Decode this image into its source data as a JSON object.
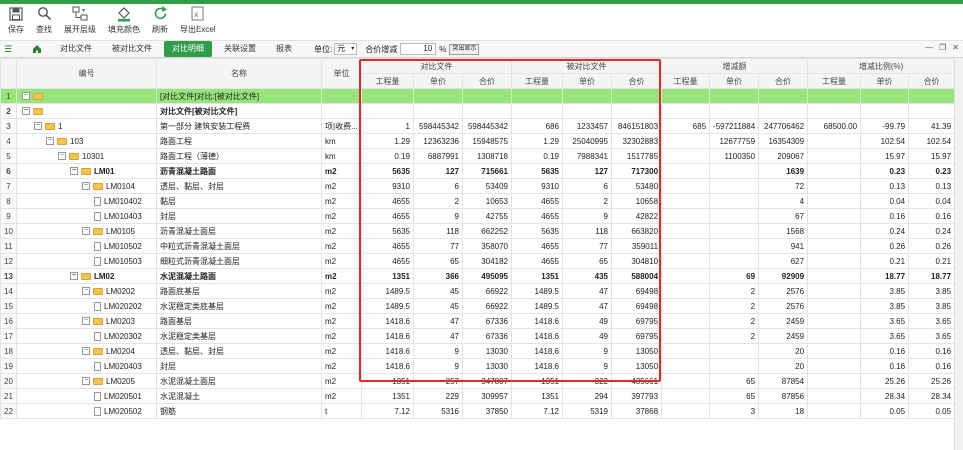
{
  "toolbar": {
    "items": [
      {
        "label": "保存",
        "icon": "save-icon"
      },
      {
        "label": "查找",
        "icon": "search-icon"
      },
      {
        "label": "展开层级",
        "icon": "expand-icon"
      },
      {
        "label": "填充颜色",
        "icon": "paint-bucket-icon"
      },
      {
        "label": "刷新",
        "icon": "refresh-icon"
      },
      {
        "label": "导出Excel",
        "icon": "excel-icon"
      }
    ]
  },
  "tabs": {
    "items": [
      "对比文件",
      "被对比文件",
      "对比明细",
      "关联设置",
      "报表"
    ],
    "active_index": 2,
    "unit_label": "单位:",
    "unit_value": "元",
    "ratio_label": "合价增减",
    "ratio_value": "10",
    "ratio_unit": "%",
    "display_button": "突出显示"
  },
  "colors": {
    "accent": "#2f9e49",
    "highlight_row": "#97e57a",
    "red_box": "#e02b2b"
  },
  "grid": {
    "headers": {
      "code": "编号",
      "name": "名称",
      "unit": "单位",
      "group_compare": "对比文件",
      "group_target": "被对比文件",
      "group_delta": "增减额",
      "group_ratio": "增减比例(%)",
      "qty": "工程量",
      "price": "单价",
      "total": "合价"
    },
    "rows": [
      {
        "rn": "1",
        "code": "",
        "level": 0,
        "kind": "folder",
        "name": "[对比文件]对比:[被对比文件]",
        "unit": "",
        "c": [
          "",
          "",
          "",
          "",
          "",
          "",
          "",
          "",
          "",
          "",
          "",
          ""
        ],
        "style": "green"
      },
      {
        "rn": "2",
        "code": "",
        "level": 0,
        "kind": "folder",
        "name": "对比文件[被对比文件]",
        "unit": "",
        "c": [
          "",
          "",
          "",
          "",
          "",
          "",
          "",
          "",
          "",
          "",
          "",
          ""
        ],
        "style": "bold"
      },
      {
        "rn": "3",
        "code": "1",
        "level": 1,
        "kind": "folder",
        "name": "第一部分 建筑安装工程费",
        "unit": "项|收费...",
        "c": [
          "1",
          "598445342",
          "598445342",
          "686",
          "1233457",
          "846151803",
          "685",
          "-597211884",
          "247706462",
          "68500.00",
          "-99.79",
          "41.39"
        ]
      },
      {
        "rn": "4",
        "code": "103",
        "level": 2,
        "kind": "folder",
        "name": "路面工程",
        "unit": "km",
        "c": [
          "1.29",
          "12363236",
          "15948575",
          "1.29",
          "25040995",
          "32302883",
          "",
          "12677759",
          "16354309",
          "",
          "102.54",
          "102.54"
        ]
      },
      {
        "rn": "5",
        "code": "10301",
        "level": 3,
        "kind": "folder",
        "name": "路面工程（薄德）",
        "unit": "km",
        "c": [
          "0.19",
          "6887991",
          "1308718",
          "0.19",
          "7988341",
          "1517785",
          "",
          "1100350",
          "209067",
          "",
          "15.97",
          "15.97"
        ]
      },
      {
        "rn": "6",
        "code": "LM01",
        "level": 4,
        "kind": "folder",
        "name": "沥青混凝土路面",
        "unit": "m2",
        "c": [
          "5635",
          "127",
          "715661",
          "5635",
          "127",
          "717300",
          "",
          "",
          "1639",
          "",
          "0.23",
          "0.23"
        ],
        "style": "bold"
      },
      {
        "rn": "7",
        "code": "LM0104",
        "level": 5,
        "kind": "folder",
        "name": "透层、黏层、封层",
        "unit": "m2",
        "c": [
          "9310",
          "6",
          "53409",
          "9310",
          "6",
          "53480",
          "",
          "",
          "72",
          "",
          "0.13",
          "0.13"
        ]
      },
      {
        "rn": "8",
        "code": "LM010402",
        "level": 6,
        "kind": "doc",
        "name": "黏层",
        "unit": "m2",
        "c": [
          "4655",
          "2",
          "10653",
          "4655",
          "2",
          "10658",
          "",
          "",
          "4",
          "",
          "0.04",
          "0.04"
        ]
      },
      {
        "rn": "9",
        "code": "LM010403",
        "level": 6,
        "kind": "doc",
        "name": "封层",
        "unit": "m2",
        "c": [
          "4655",
          "9",
          "42755",
          "4655",
          "9",
          "42822",
          "",
          "",
          "67",
          "",
          "0.16",
          "0.16"
        ]
      },
      {
        "rn": "10",
        "code": "LM0105",
        "level": 5,
        "kind": "folder",
        "name": "沥青混凝土面层",
        "unit": "m2",
        "c": [
          "5635",
          "118",
          "662252",
          "5635",
          "118",
          "663820",
          "",
          "",
          "1568",
          "",
          "0.24",
          "0.24"
        ]
      },
      {
        "rn": "11",
        "code": "LM010502",
        "level": 6,
        "kind": "doc",
        "name": "中粒式沥青混凝土面层",
        "unit": "m2",
        "c": [
          "4655",
          "77",
          "358070",
          "4655",
          "77",
          "359011",
          "",
          "",
          "941",
          "",
          "0.26",
          "0.26"
        ]
      },
      {
        "rn": "12",
        "code": "LM010503",
        "level": 6,
        "kind": "doc",
        "name": "细粒式沥青混凝土面层",
        "unit": "m2",
        "c": [
          "4655",
          "65",
          "304182",
          "4655",
          "65",
          "304810",
          "",
          "",
          "627",
          "",
          "0.21",
          "0.21"
        ]
      },
      {
        "rn": "13",
        "code": "LM02",
        "level": 4,
        "kind": "folder",
        "name": "水泥混凝土路面",
        "unit": "m2",
        "c": [
          "1351",
          "366",
          "495095",
          "1351",
          "435",
          "588004",
          "",
          "69",
          "92909",
          "",
          "18.77",
          "18.77"
        ],
        "style": "bold"
      },
      {
        "rn": "14",
        "code": "LM0202",
        "level": 5,
        "kind": "folder",
        "name": "路面底基层",
        "unit": "m2",
        "c": [
          "1489.5",
          "45",
          "66922",
          "1489.5",
          "47",
          "69498",
          "",
          "2",
          "2576",
          "",
          "3.85",
          "3.85"
        ]
      },
      {
        "rn": "15",
        "code": "LM020202",
        "level": 6,
        "kind": "doc",
        "name": "水泥稳定类底基层",
        "unit": "m2",
        "c": [
          "1489.5",
          "45",
          "66922",
          "1489.5",
          "47",
          "69498",
          "",
          "2",
          "2576",
          "",
          "3.85",
          "3.85"
        ]
      },
      {
        "rn": "16",
        "code": "LM0203",
        "level": 5,
        "kind": "folder",
        "name": "路面基层",
        "unit": "m2",
        "c": [
          "1418.6",
          "47",
          "67336",
          "1418.6",
          "49",
          "69795",
          "",
          "2",
          "2459",
          "",
          "3.65",
          "3.65"
        ]
      },
      {
        "rn": "17",
        "code": "LM020302",
        "level": 6,
        "kind": "doc",
        "name": "水泥稳定类基层",
        "unit": "m2",
        "c": [
          "1418.6",
          "47",
          "67336",
          "1418.6",
          "49",
          "69795",
          "",
          "2",
          "2459",
          "",
          "3.65",
          "3.65"
        ]
      },
      {
        "rn": "18",
        "code": "LM0204",
        "level": 5,
        "kind": "folder",
        "name": "透层、黏层、封层",
        "unit": "m2",
        "c": [
          "1418.6",
          "9",
          "13030",
          "1418.6",
          "9",
          "13050",
          "",
          "",
          "20",
          "",
          "0.16",
          "0.16"
        ]
      },
      {
        "rn": "19",
        "code": "LM020403",
        "level": 6,
        "kind": "doc",
        "name": "封层",
        "unit": "m2",
        "c": [
          "1418.6",
          "9",
          "13030",
          "1418.6",
          "9",
          "13050",
          "",
          "",
          "20",
          "",
          "0.16",
          "0.16"
        ]
      },
      {
        "rn": "20",
        "code": "LM0205",
        "level": 5,
        "kind": "folder",
        "name": "水泥混凝土面层",
        "unit": "m2",
        "c": [
          "1351",
          "257",
          "347807",
          "1351",
          "322",
          "435661",
          "",
          "65",
          "87854",
          "",
          "25.26",
          "25.26"
        ]
      },
      {
        "rn": "21",
        "code": "LM020501",
        "level": 6,
        "kind": "doc",
        "name": "水泥混凝土",
        "unit": "m2",
        "c": [
          "1351",
          "229",
          "309957",
          "1351",
          "294",
          "397793",
          "",
          "65",
          "87856",
          "",
          "28.34",
          "28.34"
        ]
      },
      {
        "rn": "22",
        "code": "LM020502",
        "level": 6,
        "kind": "doc",
        "name": "钢筋",
        "unit": "t",
        "c": [
          "7.12",
          "5316",
          "37850",
          "7.12",
          "5319",
          "37868",
          "",
          "3",
          "18",
          "",
          "0.05",
          "0.05"
        ]
      }
    ]
  }
}
